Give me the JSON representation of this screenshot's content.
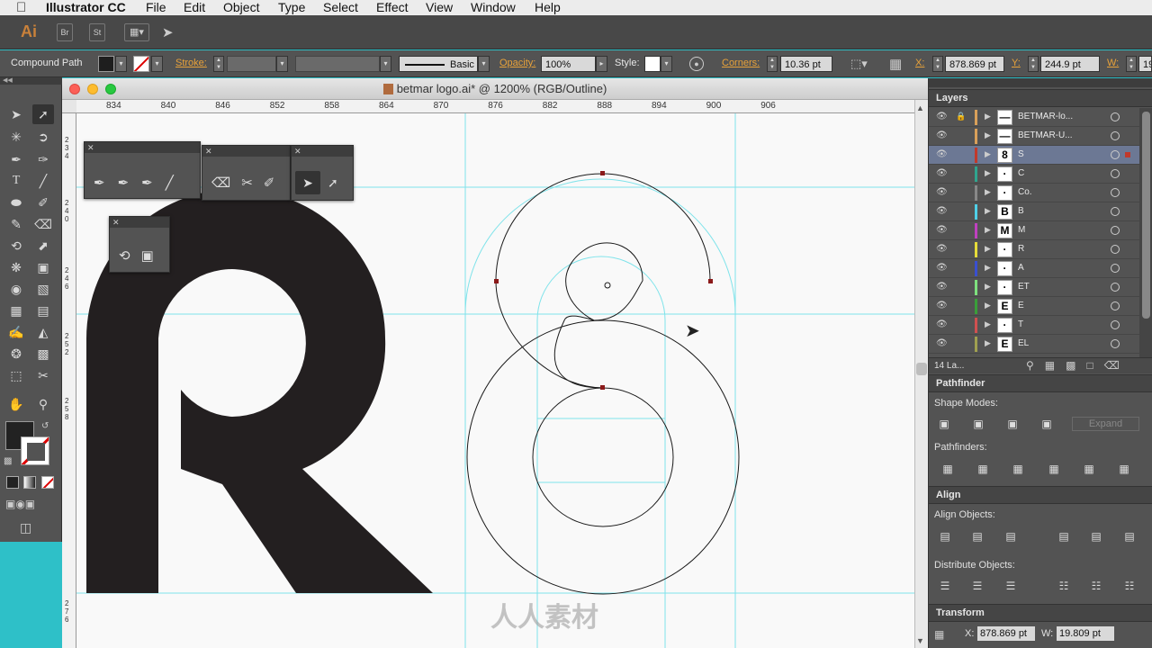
{
  "menubar": {
    "apple": "",
    "app": "Illustrator CC",
    "items": [
      "File",
      "Edit",
      "Object",
      "Type",
      "Select",
      "Effect",
      "View",
      "Window",
      "Help"
    ]
  },
  "appbar": {
    "logo": "Ai",
    "bridge": "Br",
    "stock": "St"
  },
  "control": {
    "selection_label": "Compound Path",
    "stroke_label": "Stroke:",
    "brush_value": "Basic",
    "opacity_label": "Opacity:",
    "opacity_value": "100%",
    "style_label": "Style:",
    "corners_label": "Corners:",
    "corners_value": "10.36 pt",
    "x_label": "X:",
    "x_value": "878.869 pt",
    "y_label": "Y:",
    "y_value": "244.9 pt",
    "w_label": "W:",
    "w_value": "19"
  },
  "document": {
    "title": "betmar logo.ai* @ 1200% (RGB/Outline)",
    "ruler_ticks": [
      "834",
      "840",
      "846",
      "852",
      "858",
      "864",
      "870",
      "876",
      "882",
      "888",
      "894",
      "900",
      "906"
    ],
    "vruler_ticks": [
      "2\n3\n4",
      "2\n4\n0",
      "2\n4\n6",
      "2\n5\n2",
      "2\n5\n8",
      "2\n7\n6"
    ],
    "watermark": "人人素材"
  },
  "layers": {
    "title": "Layers",
    "count_label": "14 La...",
    "rows": [
      {
        "name": "BETMAR-lo...",
        "color": "#d9a05a",
        "thumb": "—"
      },
      {
        "name": "BETMAR-U...",
        "color": "#d9a05a",
        "thumb": "—"
      },
      {
        "name": "S",
        "color": "#c0392b",
        "thumb": "8",
        "selected": true
      },
      {
        "name": "C",
        "color": "#2fa58e",
        "thumb": "·"
      },
      {
        "name": "Co.",
        "color": "#888888",
        "thumb": "·"
      },
      {
        "name": "B",
        "color": "#4fd0e8",
        "thumb": "B"
      },
      {
        "name": "M",
        "color": "#c040c0",
        "thumb": "M"
      },
      {
        "name": "R",
        "color": "#e6dc3a",
        "thumb": "·"
      },
      {
        "name": "A",
        "color": "#3a4fd0",
        "thumb": "·"
      },
      {
        "name": "ET",
        "color": "#7ee07e",
        "thumb": "·"
      },
      {
        "name": "E",
        "color": "#3a9e3a",
        "thumb": "E"
      },
      {
        "name": "T",
        "color": "#d05050",
        "thumb": "·"
      },
      {
        "name": "EL",
        "color": "#a0a050",
        "thumb": "E"
      }
    ]
  },
  "pathfinder": {
    "title": "Pathfinder",
    "shape_modes": "Shape Modes:",
    "expand": "Expand",
    "pathfinders": "Pathfinders:"
  },
  "align": {
    "title": "Align",
    "align_objects": "Align Objects:",
    "distribute_objects": "Distribute Objects:"
  },
  "transform": {
    "title": "Transform",
    "x_label": "X:",
    "x_value": "878.869 pt",
    "w_label": "W:",
    "w_value": "19.809 pt"
  },
  "colors": {
    "accent_orange": "#e8a23a",
    "guide": "#7fe3ea",
    "selected_layer": "#6c7894",
    "anchor": "#8b1a1a"
  }
}
